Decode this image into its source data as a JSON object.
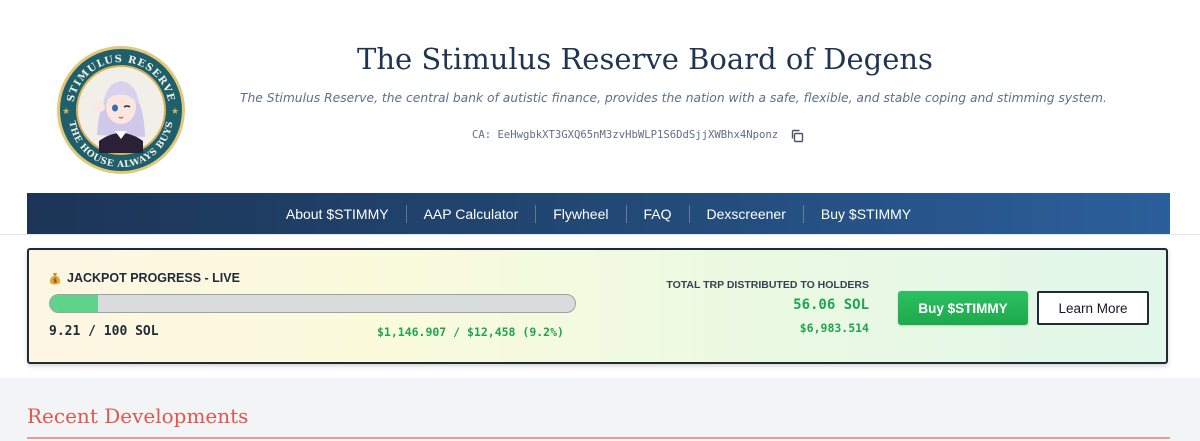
{
  "header": {
    "title": "The Stimulus Reserve Board of Degens",
    "subtitle": "The Stimulus Reserve, the central bank of autistic finance, provides the nation with a safe, flexible, and stable coping and stimming system.",
    "contract_address": "CA: EeHwgbkXT3GXQ65nM3zvHbWLP1S6DdSjjXWBhx4Nponz",
    "logo": {
      "top_text": "STIMULUS RESERVE",
      "bottom_text": "THE HOUSE ALWAYS BUYS",
      "icon": "reserve-seal-logo"
    }
  },
  "nav": {
    "items": [
      {
        "label": "About $STIMMY"
      },
      {
        "label": "AAP Calculator"
      },
      {
        "label": "Flywheel"
      },
      {
        "label": "FAQ"
      },
      {
        "label": "Dexscreener"
      },
      {
        "label": "Buy $STIMMY"
      }
    ]
  },
  "jackpot": {
    "title": "JACKPOT PROGRESS - LIVE",
    "title_icon": "moneybag-icon",
    "progress_percent": 9.21,
    "sol_text": "9.21 / 100 SOL",
    "usd_text": "$1,146.907 / $12,458 (9.2%)",
    "trp_label": "TOTAL TRP DISTRIBUTED TO HOLDERS",
    "trp_sol": "56.06 SOL",
    "trp_usd": "$6,983.514",
    "buy_label": "Buy $STIMMY",
    "learn_label": "Learn More"
  },
  "recent": {
    "title": "Recent Developments"
  },
  "colors": {
    "nav_dark": "#1c3556",
    "nav_light": "#2b5f9b",
    "title": "#1f3552",
    "green": "#22a351",
    "accent_red": "#e0574f",
    "seal_teal": "#1e5f6a",
    "seal_gold": "#d7b25a"
  }
}
